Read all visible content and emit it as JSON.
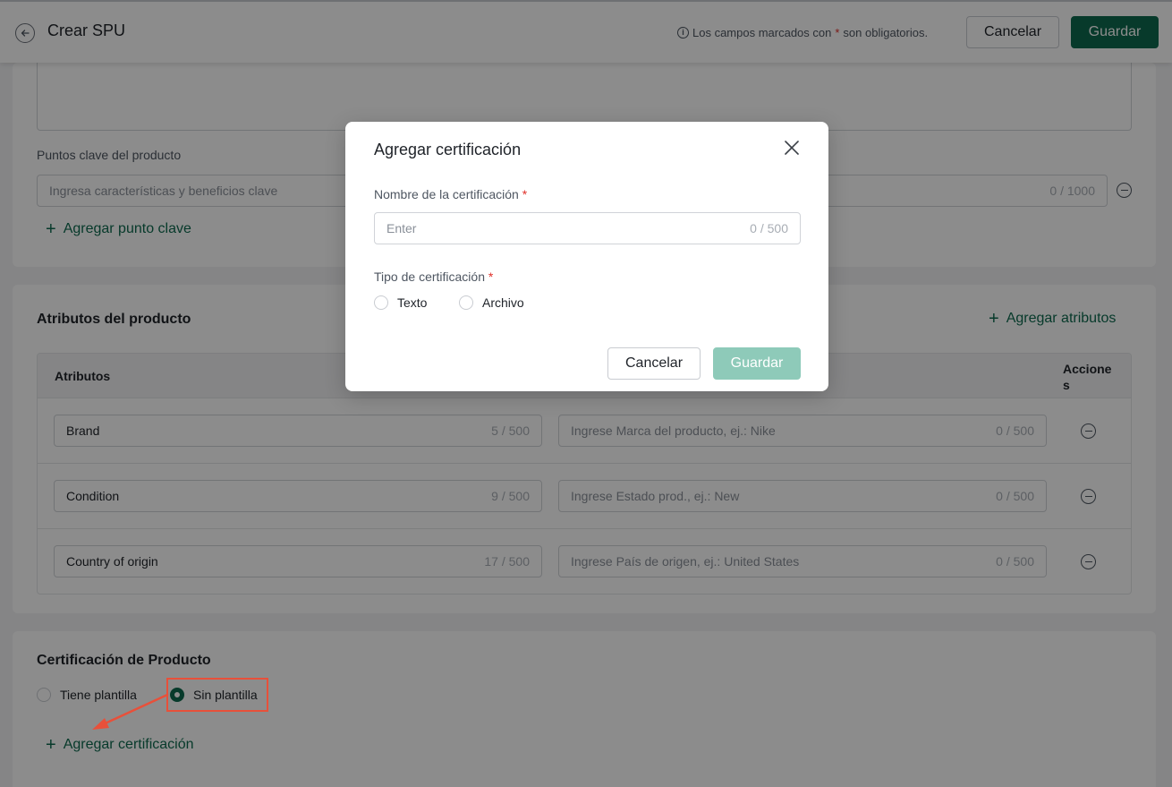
{
  "header": {
    "title": "Crear SPU",
    "required_note_pre": "Los campos marcados con",
    "required_star": "*",
    "required_note_post": "son obligatorios.",
    "cancel_label": "Cancelar",
    "save_label": "Guardar"
  },
  "key_points": {
    "label": "Puntos clave del producto",
    "placeholder": "Ingresa características y beneficios clave",
    "counter": "0 / 1000",
    "add_label": "Agregar punto clave"
  },
  "attributes": {
    "title": "Atributos del producto",
    "add_label": "Agregar atributos",
    "col_attributes": "Atributos",
    "col_actions_1": "Accione",
    "col_actions_2": "s",
    "rows": [
      {
        "name": "Brand",
        "name_count": "5 / 500",
        "value_placeholder": "Ingrese Marca del producto, ej.: Nike",
        "value_count": "0 / 500"
      },
      {
        "name": "Condition",
        "name_count": "9 / 500",
        "value_placeholder": "Ingrese Estado prod., ej.: New",
        "value_count": "0 / 500"
      },
      {
        "name": "Country of origin",
        "name_count": "17 / 500",
        "value_placeholder": "Ingrese País de origen, ej.: United States",
        "value_count": "0 / 500"
      }
    ]
  },
  "certification": {
    "title": "Certificación de Producto",
    "option_template": "Tiene plantilla",
    "option_no_template": "Sin plantilla",
    "selected": "Sin plantilla",
    "add_label": "Agregar certificación"
  },
  "modal": {
    "title": "Agregar certificación",
    "name_label": "Nombre de la certificación",
    "name_placeholder": "Enter",
    "name_counter": "0 / 500",
    "type_label": "Tipo de certificación",
    "type_options": [
      "Texto",
      "Archivo"
    ],
    "required_star": "*",
    "cancel_label": "Cancelar",
    "save_label": "Guardar"
  },
  "colors": {
    "primary": "#0e6b4f",
    "primary_disabled": "#8ecab9",
    "required": "#e0302a",
    "annotation": "#e8503a"
  }
}
